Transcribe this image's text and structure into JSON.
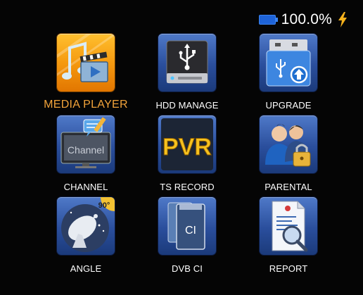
{
  "status": {
    "battery_percent": "100.0%",
    "battery_icon": "battery-icon",
    "charging_icon": "lightning-bolt-icon"
  },
  "colors": {
    "background": "#050505",
    "tile_blue": "#2a4e9c",
    "tile_selected": "#f59a10",
    "selected_label": "#f2a33a",
    "label": "#ffffff"
  },
  "menu": {
    "selected": "MEDIA PLAYER",
    "items": [
      {
        "label": "MEDIA PLAYER",
        "icon": "media-player-icon"
      },
      {
        "label": "HDD MANAGE",
        "icon": "hdd-manage-icon"
      },
      {
        "label": "UPGRADE",
        "icon": "upgrade-icon"
      },
      {
        "label": "CHANNEL",
        "icon": "channel-icon",
        "icon_text": "Channel"
      },
      {
        "label": "TS RECORD",
        "icon": "pvr-icon",
        "icon_text": "PVR"
      },
      {
        "label": "PARENTAL",
        "icon": "parental-lock-icon"
      },
      {
        "label": "ANGLE",
        "icon": "satellite-dish-icon",
        "icon_text": "90°"
      },
      {
        "label": "DVB CI",
        "icon": "ci-card-icon",
        "icon_text": "CI"
      },
      {
        "label": "REPORT",
        "icon": "report-icon"
      }
    ]
  }
}
